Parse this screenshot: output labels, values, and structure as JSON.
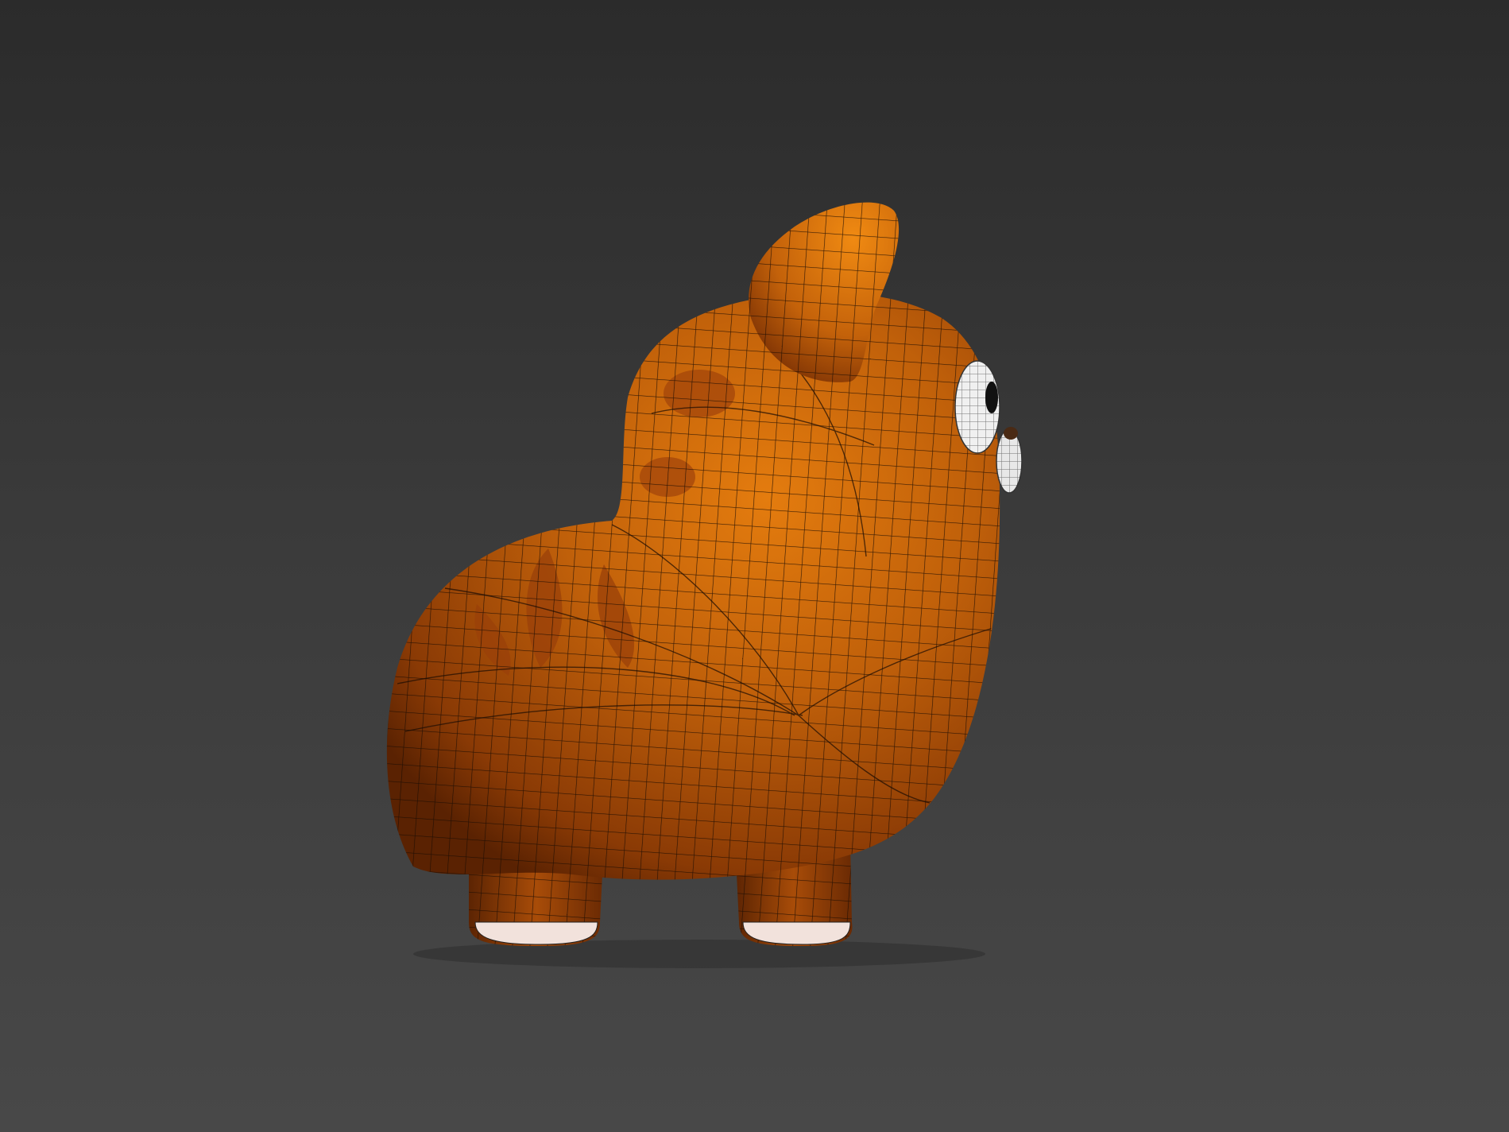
{
  "viewport": {
    "label": "",
    "background_top": "#2b2b2b",
    "background_bottom": "#484848"
  },
  "model": {
    "subject": "cartoon-cat-figurine",
    "view": "side",
    "display_mode": "shaded-with-wireframe",
    "colors": {
      "body": "#c0600a",
      "body_highlight": "#e0780c",
      "body_shadow": "#6a2a04",
      "stripe": "#a3460b",
      "paw_tip": "#f2e2dc",
      "eye_white": "#f0f0f0",
      "wire": "#1a0c04"
    }
  }
}
